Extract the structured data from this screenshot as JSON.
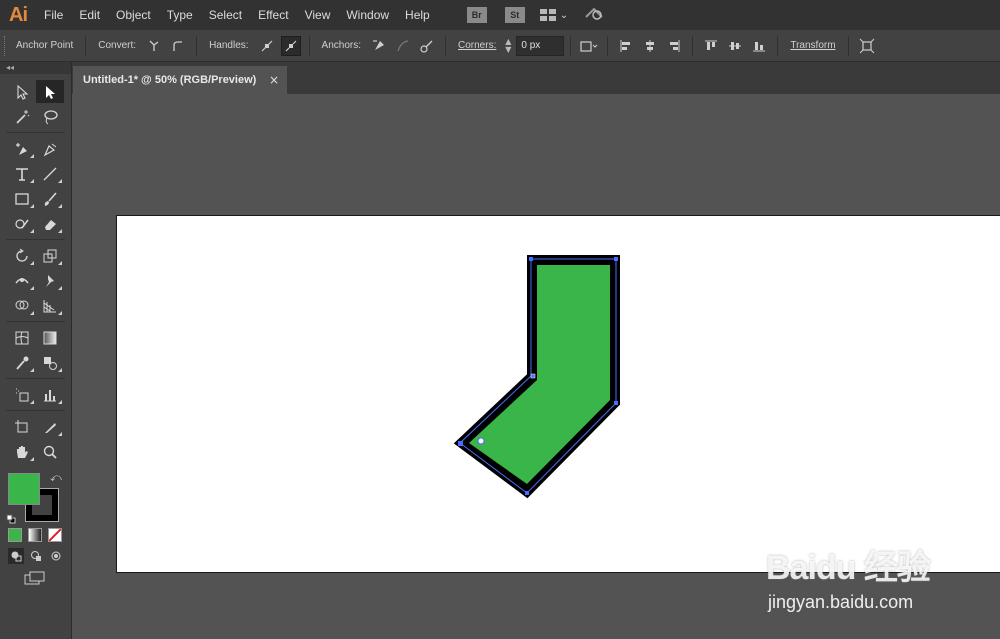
{
  "app": {
    "logo_text": "Ai"
  },
  "menu": {
    "items": [
      "File",
      "Edit",
      "Object",
      "Type",
      "Select",
      "Effect",
      "View",
      "Window",
      "Help"
    ],
    "bridge_label": "Br",
    "stock_label": "St"
  },
  "controlbar": {
    "mode_label": "Anchor Point",
    "convert_label": "Convert:",
    "handles_label": "Handles:",
    "anchors_label": "Anchors:",
    "corners_label": "Corners:",
    "corners_value": "0 px",
    "transform_label": "Transform"
  },
  "document": {
    "tab_title": "Untitled-1* @ 50% (RGB/Preview)",
    "close_glyph": "×"
  },
  "colors": {
    "fill": "#39b54a",
    "stroke": "#000000",
    "selection": "#4a6cff"
  },
  "watermark": {
    "main": "Baidu 经验",
    "sub": "jingyan.baidu.com"
  }
}
